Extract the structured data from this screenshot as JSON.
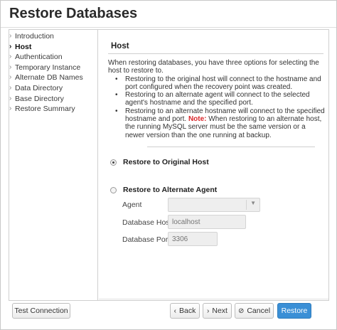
{
  "dialog": {
    "title": "Restore Databases"
  },
  "sidebar": {
    "items": [
      {
        "label": "Introduction",
        "active": false
      },
      {
        "label": "Host",
        "active": true
      },
      {
        "label": "Authentication",
        "active": false
      },
      {
        "label": "Temporary Instance",
        "active": false
      },
      {
        "label": "Alternate DB Names",
        "active": false
      },
      {
        "label": "Data Directory",
        "active": false
      },
      {
        "label": "Base Directory",
        "active": false
      },
      {
        "label": "Restore Summary",
        "active": false
      }
    ]
  },
  "host": {
    "section_title": "Host",
    "intro": "When restoring databases, you have three options for selecting the host to restore to.",
    "bullet1": "Restoring to the original host will connect to the hostname and port configured when the recovery point was created.",
    "bullet2": "Restoring to an alternate agent will connect to the selected agent's hostname and the specified port.",
    "bullet3_a": "Restoring to an alternate hostname will connect to the specified hostname and port.",
    "note_label": "Note:",
    "bullet3_b": "When restoring to an alternate host, the running MySQL server must be the same version or a newer version than the one running at backup.",
    "option_original": "Restore to Original Host",
    "option_alternate": "Restore to Alternate Agent",
    "selected_option": "original",
    "agent_label": "Agent",
    "agent_value": "",
    "db_host_label": "Database Host",
    "db_host_placeholder": "localhost",
    "db_port_label": "Database Port",
    "db_port_placeholder": "3306"
  },
  "footer": {
    "test_connection": "Test Connection",
    "back": "Back",
    "next": "Next",
    "cancel": "Cancel",
    "restore": "Restore"
  },
  "icons": {
    "chevron": "›",
    "back": "‹",
    "next": "›",
    "cancel": "⊘"
  },
  "colors": {
    "primary": "#3a8fd6",
    "note": "#d9262a"
  }
}
